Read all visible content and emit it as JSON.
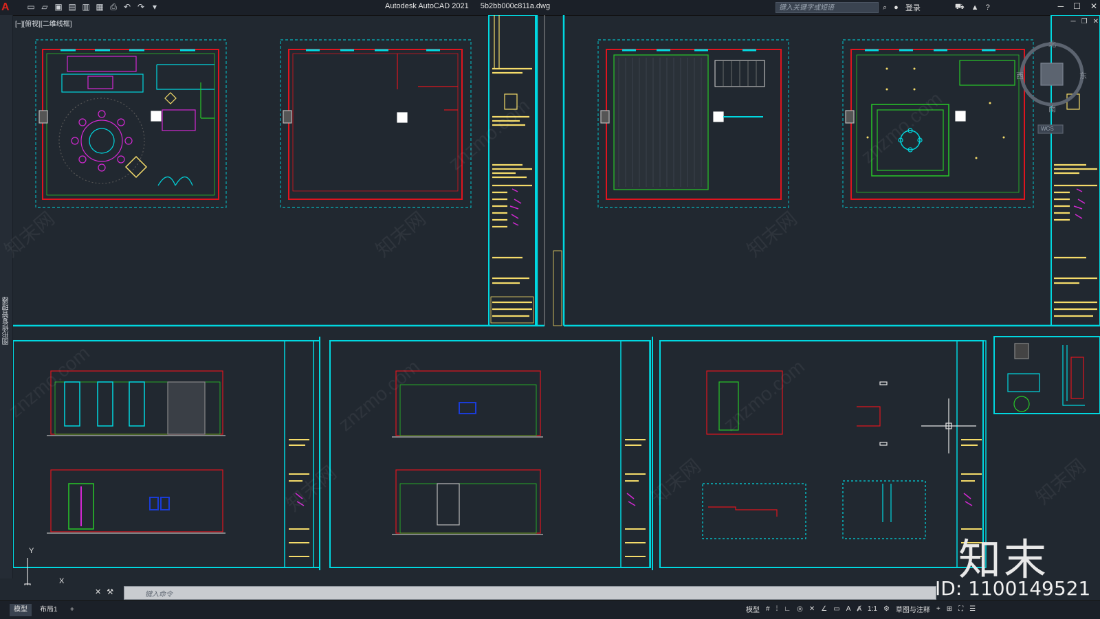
{
  "app": {
    "logo": "A",
    "name": "Autodesk AutoCAD 2021",
    "file": "5b2bb000c811a.dwg",
    "search_placeholder": "键入关键字或短语",
    "login_label": "登录",
    "help_label": "?"
  },
  "view": {
    "label": "[−][俯视][二维线框]",
    "side_panel_label": "图形修复管理器",
    "compass": {
      "north": "北",
      "east": "东",
      "south": "南",
      "west": "西",
      "wcs": "WCS"
    }
  },
  "ucs": {
    "x_label": "X",
    "y_label": "Y"
  },
  "command": {
    "placeholder": "键入命令"
  },
  "layout_tabs": [
    {
      "label": "模型",
      "active": true
    },
    {
      "label": "布局1",
      "active": false
    }
  ],
  "add_tab_label": "+",
  "status": {
    "model_label": "模型",
    "scale_label": "1:1",
    "workspace_label": "草图与注释"
  },
  "watermarks": {
    "site": "znzmo.com",
    "cn": "知末网",
    "brand": "知末",
    "id": "ID: 1100149521"
  },
  "colors": {
    "background": "#212830",
    "cyan": "#00d8e0",
    "red": "#e0141e",
    "magenta": "#d428d4",
    "yellow": "#f5dc6a",
    "green": "#28c828",
    "white": "#e6e6e6"
  }
}
